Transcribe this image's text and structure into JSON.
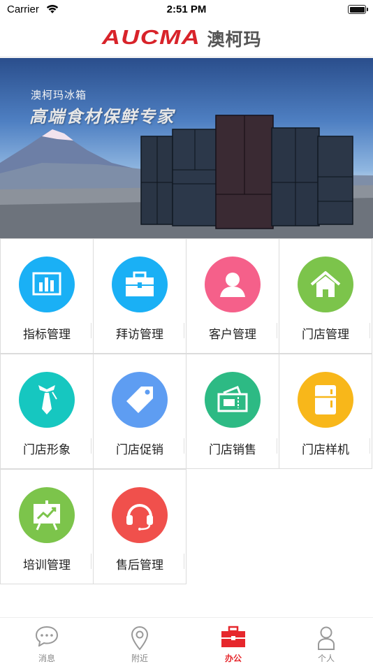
{
  "status_bar": {
    "carrier": "Carrier",
    "time": "2:51 PM"
  },
  "header": {
    "logo_en": "AUCMA",
    "logo_cn": "澳柯玛",
    "brand_color": "#d8232a"
  },
  "banner": {
    "subtitle": "澳柯玛冰箱",
    "title": "高端食材保鲜专家"
  },
  "grid_items": [
    {
      "label": "指标管理",
      "icon": "bar-chart-icon",
      "color": "#1ab0f5"
    },
    {
      "label": "拜访管理",
      "icon": "briefcase-icon",
      "color": "#1ab0f5"
    },
    {
      "label": "客户管理",
      "icon": "user-icon",
      "color": "#f5608a"
    },
    {
      "label": "门店管理",
      "icon": "home-icon",
      "color": "#7cc44b"
    },
    {
      "label": "门店形象",
      "icon": "tie-icon",
      "color": "#16c7c0"
    },
    {
      "label": "门店促销",
      "icon": "tag-icon",
      "color": "#5e9df2"
    },
    {
      "label": "门店销售",
      "icon": "ticket-icon",
      "color": "#2dba84"
    },
    {
      "label": "门店样机",
      "icon": "fridge-icon",
      "color": "#f8b71a"
    },
    {
      "label": "培训管理",
      "icon": "presentation-icon",
      "color": "#7cc44b"
    },
    {
      "label": "售后管理",
      "icon": "headset-icon",
      "color": "#f0504c"
    }
  ],
  "tabbar": {
    "items": [
      {
        "label": "消息",
        "icon": "chat-icon"
      },
      {
        "label": "附近",
        "icon": "location-pin-icon"
      },
      {
        "label": "办公",
        "icon": "toolbox-icon",
        "active": true
      },
      {
        "label": "个人",
        "icon": "person-icon"
      }
    ],
    "active_color": "#e6272c"
  }
}
